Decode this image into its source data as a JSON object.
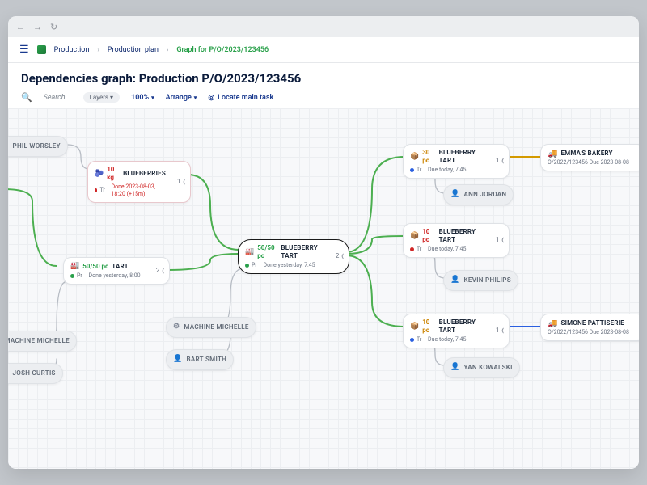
{
  "browser": {
    "back": "←",
    "fwd": "→",
    "reload": "↻"
  },
  "crumbs": {
    "c1": "Production",
    "c2": "Production plan",
    "c3": "Graph for P/O/2023/123456"
  },
  "title": "Dependencies graph: Production P/O/2023/123456",
  "toolbar": {
    "search": "Search …",
    "layers": "Layers",
    "zoom": "100%",
    "arrange": "Arrange",
    "locate": "Locate main task"
  },
  "people": {
    "phil": "PHIL WORSLEY",
    "michelle": "MACHINE MICHELLE",
    "josh": "JOSH CURTIS",
    "bart": "BART SMITH",
    "michelle2": "MACHINE MICHELLE",
    "ann": "ANN JORDAN",
    "kevin": "KEVIN PHILIPS",
    "yan": "YAN KOWALSKI"
  },
  "tasks": {
    "blue": {
      "qty": "10 kg",
      "name": "BLUEBERRIES",
      "pre": "Tr",
      "sub": "Done 2023-08-03, 18:20 (+15m)",
      "count": "1"
    },
    "tart": {
      "qty": "50/50 pc",
      "name": "TART",
      "pre": "Pr",
      "sub": "Done yesterday, 8:00",
      "count": "2"
    },
    "main": {
      "qty": "50/50 pc",
      "name": "BLUEBERRY TART",
      "pre": "Pr",
      "sub": "Done yesterday, 7:45",
      "count": "2"
    },
    "bt1": {
      "qty": "30 pc",
      "name": "BLUEBERRY TART",
      "pre": "Tr",
      "sub": "Due today, 7:45",
      "count": "1"
    },
    "bt2": {
      "qty": "10 pc",
      "name": "BLUEBERRY TART",
      "pre": "Tr",
      "sub": "Due today, 7:45",
      "count": "1"
    },
    "bt3": {
      "qty": "10 pc",
      "name": "BLUEBERRY TART",
      "pre": "Tr",
      "sub": "Due today, 7:45",
      "count": "1"
    }
  },
  "dest": {
    "emma": {
      "name": "EMMA'S BAKERY",
      "meta": "O/2022/123456   Due 2023-08-08"
    },
    "simone": {
      "name": "SIMONE PATTISERIE",
      "meta": "O/2022/123456   Due 2023-08-08"
    }
  },
  "glyph": {
    "expand": "⦅"
  }
}
